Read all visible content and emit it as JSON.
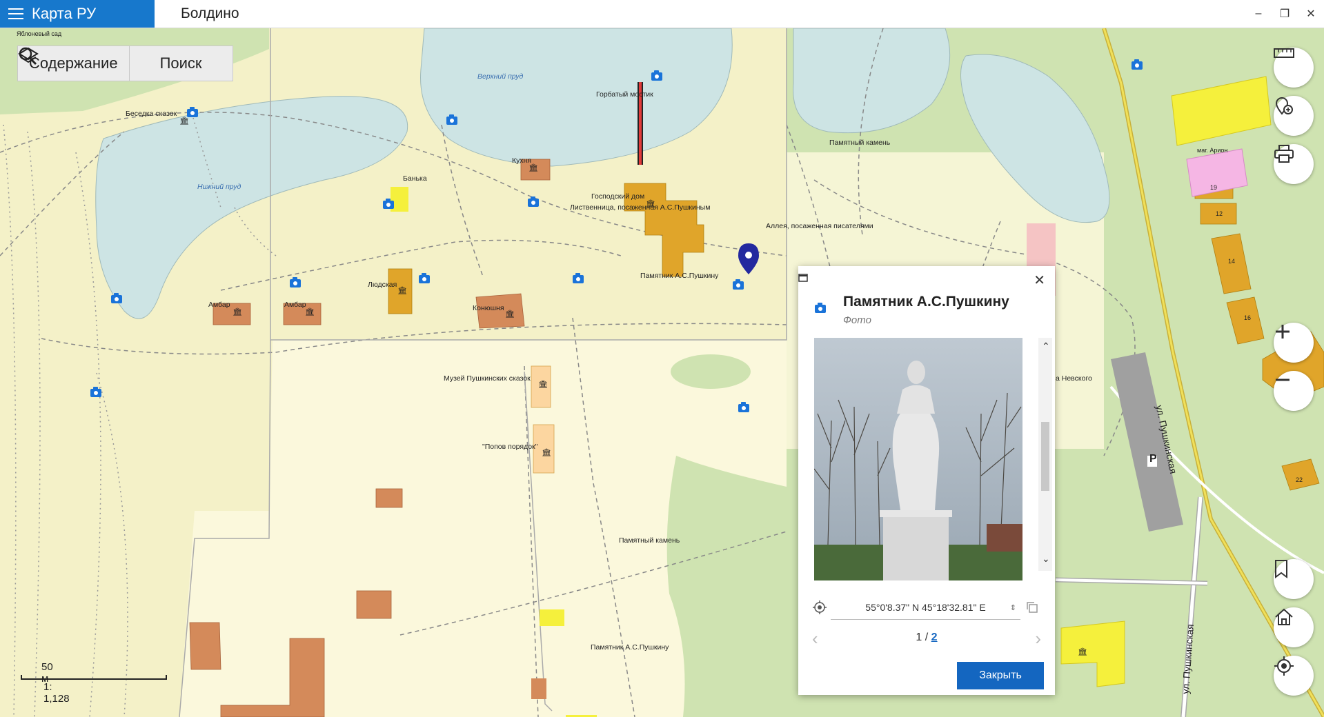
{
  "titlebar": {
    "app_name": "Карта РУ",
    "document_title": "Болдино"
  },
  "toolbar": {
    "contents_label": "Содержание",
    "search_label": "Поиск"
  },
  "map": {
    "labels": {
      "apple_garden": "Яблоневый сад",
      "upper_pond": "Верхний пруд",
      "lower_pond": "Нижний пруд",
      "humpbacked_bridge": "Горбатый мостик",
      "fairy_gazebo": "Беседка сказок",
      "kitchen": "Кухня",
      "banka": "Банька",
      "manor_house": "Господский дом",
      "larch": "Лиственница, посаженная А.С.Пушкиным",
      "writers_alley": "Аллея, посаженная писателями",
      "memorial_stone_top": "Памятный камень",
      "pushkin_monument_top": "Памятник А.С.Пушкину",
      "barn1": "Амбар",
      "barn2": "Амбар",
      "servants": "Людская",
      "stable": "Конюшня",
      "fairy_museum": "Музей Пушкинских сказок",
      "priest_order": "\"Попов порядок\"",
      "memorial_stone": "Памятный камень",
      "pushkin_monument_bottom": "Памятник А.С.Пушкину",
      "nevsky": "а Невского",
      "shop_arion": "маг. Арион",
      "street1": "ул. Пушкинская",
      "street2": "ул. Пушкинская",
      "parking": "P",
      "house_19": "19",
      "house_12": "12",
      "house_14": "14",
      "house_16": "16",
      "house_22": "22"
    },
    "scale": {
      "distance": "50 м",
      "ratio": "1: 1,128"
    }
  },
  "popup": {
    "title": "Памятник А.С.Пушкину",
    "subtitle": "Фото",
    "coordinates": "55°0'8.37\" N 45°18'32.81\" E",
    "page_current": "1",
    "page_separator": " / ",
    "page_total": "2",
    "close_label": "Закрыть"
  },
  "colors": {
    "accent": "#1466c0",
    "app_tab": "#1778cc",
    "park": "#f4f1c8",
    "water": "#cde4e4",
    "green": "#cfe3b1",
    "building": "#e0a52a"
  }
}
